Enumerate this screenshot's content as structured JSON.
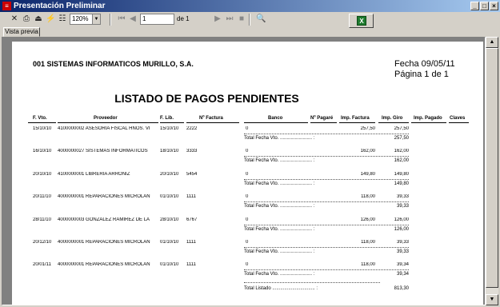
{
  "window": {
    "title": "Presentación Preliminar",
    "app_icon": "report-icon"
  },
  "toolbar": {
    "zoom": "120%",
    "page_current": "1",
    "page_of": "de 1",
    "excel_icon": "X"
  },
  "tabs": [
    {
      "label": "Vista previa"
    }
  ],
  "report": {
    "company": "001 SISTEMAS INFORMATICOS MURILLO, S.A.",
    "fecha": "Fecha 09/05/11",
    "pagina": "Página 1 de 1",
    "title": "LISTADO DE PAGOS PENDIENTES",
    "headers": [
      "F. Vto.",
      "Proveedor",
      "F. Lib.",
      "Nº Factura",
      "Banco",
      "Nº Pagaré",
      "Imp. Factura",
      "Imp. Giro",
      "Imp. Pagado",
      "Claves"
    ],
    "rows": [
      {
        "fvto": "15/10/10",
        "proveedor": "4100000002 ASESORIA FISCAL HNOS. VI",
        "flib": "15/10/10",
        "factura": "2222",
        "banco": "0",
        "imp_factura": "257,50",
        "imp_giro": "257,50",
        "total_label": "Total Fecha Vto. ........................ :",
        "total": "257,50"
      },
      {
        "fvto": "16/10/10",
        "proveedor": "4000000027 SISTEMAS INFORMATICOS",
        "flib": "18/10/10",
        "factura": "3333",
        "banco": "0",
        "imp_factura": "162,00",
        "imp_giro": "162,00",
        "total_label": "Total Fecha Vto. ........................ :",
        "total": "162,00"
      },
      {
        "fvto": "20/10/10",
        "proveedor": "4100000001 LIBRERIA ARRONIZ",
        "flib": "20/10/10",
        "factura": "5454",
        "banco": "0",
        "imp_factura": "149,80",
        "imp_giro": "149,80",
        "total_label": "Total Fecha Vto. ........................ :",
        "total": "149,80"
      },
      {
        "fvto": "20/11/10",
        "proveedor": "4000000001 REPARACIONES MICROLAN",
        "flib": "01/10/10",
        "factura": "1111",
        "banco": "0",
        "imp_factura": "118,00",
        "imp_giro": "39,33",
        "total_label": "Total Fecha Vto. ........................ :",
        "total": "39,33"
      },
      {
        "fvto": "28/11/10",
        "proveedor": "4000000003 GONZALEZ RAMIREZ DE LA",
        "flib": "28/10/10",
        "factura": "6767",
        "banco": "0",
        "imp_factura": "126,00",
        "imp_giro": "126,00",
        "total_label": "Total Fecha Vto. ........................ :",
        "total": "126,00"
      },
      {
        "fvto": "20/12/10",
        "proveedor": "4000000001 REPARACIONES MICROLAN",
        "flib": "01/10/10",
        "factura": "1111",
        "banco": "0",
        "imp_factura": "118,00",
        "imp_giro": "39,33",
        "total_label": "Total Fecha Vto. ........................ :",
        "total": "39,33"
      },
      {
        "fvto": "20/01/11",
        "proveedor": "4000000001 REPARACIONES MICROLAN",
        "flib": "01/10/10",
        "factura": "1111",
        "banco": "0",
        "imp_factura": "118,00",
        "imp_giro": "39,34",
        "total_label": "Total Fecha Vto. ........................ :",
        "total": "39,34"
      }
    ],
    "grand_total_label": "Total Listado ................................ :",
    "grand_total": "813,30"
  }
}
